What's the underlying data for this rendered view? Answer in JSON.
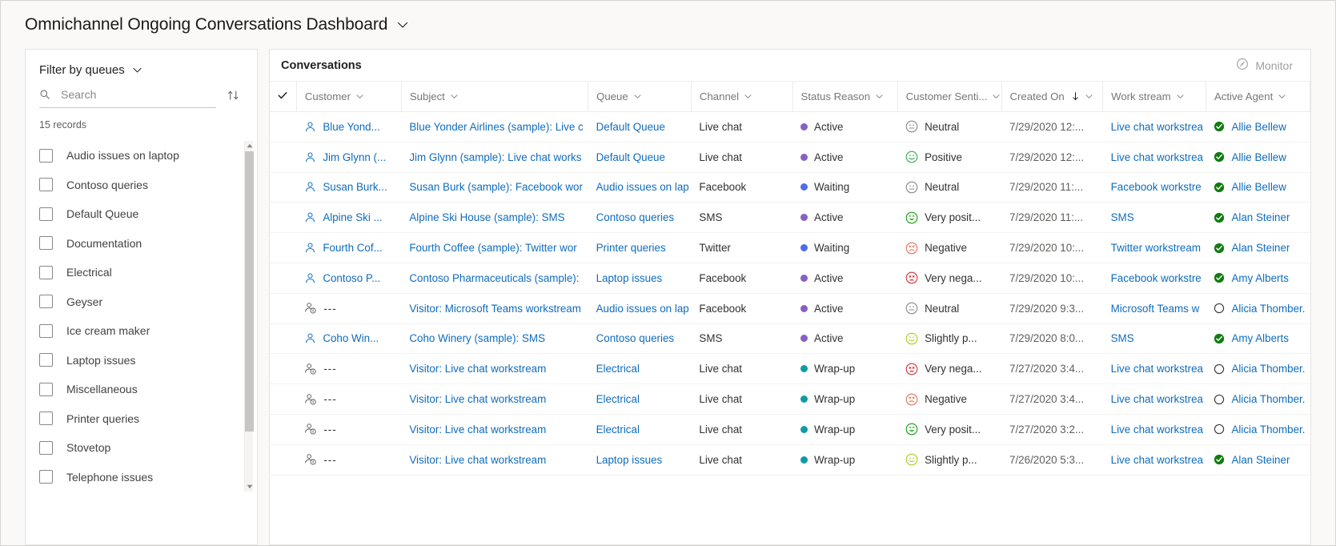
{
  "header": {
    "title": "Omnichannel Ongoing Conversations Dashboard",
    "chevron_icon": "chevron-down-icon"
  },
  "filter_panel": {
    "title": "Filter by queues",
    "chevron_icon": "chevron-down-icon",
    "search": {
      "placeholder": "Search",
      "value": "",
      "icon": "search-icon"
    },
    "sort_toggle_icon": "sort-ascending-descending-icon",
    "record_count": "15 records",
    "queues": [
      {
        "label": "Audio issues on laptop",
        "checked": false
      },
      {
        "label": "Contoso queries",
        "checked": false
      },
      {
        "label": "Default Queue",
        "checked": false
      },
      {
        "label": "Documentation",
        "checked": false
      },
      {
        "label": "Electrical",
        "checked": false
      },
      {
        "label": "Geyser",
        "checked": false
      },
      {
        "label": "Ice cream maker",
        "checked": false
      },
      {
        "label": "Laptop issues",
        "checked": false
      },
      {
        "label": "Miscellaneous",
        "checked": false
      },
      {
        "label": "Printer queries",
        "checked": false
      },
      {
        "label": "Stovetop",
        "checked": false
      },
      {
        "label": "Telephone issues",
        "checked": false
      }
    ]
  },
  "grid": {
    "title": "Conversations",
    "monitor": {
      "label": "Monitor",
      "icon": "gauge-icon"
    },
    "select_all_icon": "checkmark-icon",
    "columns": [
      {
        "label": "Customer",
        "chevron": true,
        "sorted": false
      },
      {
        "label": "Subject",
        "chevron": true,
        "sorted": false
      },
      {
        "label": "Queue",
        "chevron": true,
        "sorted": false
      },
      {
        "label": "Channel",
        "chevron": true,
        "sorted": false
      },
      {
        "label": "Status Reason",
        "chevron": true,
        "sorted": false
      },
      {
        "label": "Customer Senti...",
        "chevron": true,
        "sorted": false
      },
      {
        "label": "Created On",
        "chevron": true,
        "sorted": true,
        "sort_dir": "desc"
      },
      {
        "label": "Work stream",
        "chevron": true,
        "sorted": false
      },
      {
        "label": "Active Agent",
        "chevron": true,
        "sorted": false
      }
    ],
    "status_colors": {
      "Active": "#8661c5",
      "Waiting": "#4f6bed",
      "Wrap-up": "#0e9aa7"
    },
    "sentiment_colors": {
      "Neutral": "#8a8886",
      "Positive": "#3aa655",
      "Very posit...": "#13a10e",
      "Slightly p...": "#a4cf20",
      "Negative": "#e86f54",
      "Very nega...": "#d13438"
    },
    "rows": [
      {
        "customer": "Blue Yond...",
        "customer_icon": "person-icon",
        "subject": "Blue Yonder Airlines (sample): Live c",
        "queue": "Default Queue",
        "queue_link": true,
        "channel": "Live chat",
        "status": "Active",
        "sentiment": "Neutral",
        "created_on": "7/29/2020 12:...",
        "work_stream": "Live chat workstrea",
        "agent": "Allie Bellew",
        "agent_state": "available"
      },
      {
        "customer": "Jim Glynn (...",
        "customer_icon": "person-icon",
        "subject": "Jim Glynn (sample): Live chat works",
        "queue": "Default Queue",
        "queue_link": true,
        "channel": "Live chat",
        "status": "Active",
        "sentiment": "Positive",
        "created_on": "7/29/2020 12:...",
        "work_stream": "Live chat workstrea",
        "agent": "Allie Bellew",
        "agent_state": "available"
      },
      {
        "customer": "Susan Burk...",
        "customer_icon": "person-icon",
        "subject": "Susan Burk (sample): Facebook wor",
        "queue": "Audio issues on lap",
        "queue_link": true,
        "channel": "Facebook",
        "status": "Waiting",
        "sentiment": "Neutral",
        "created_on": "7/29/2020 11:...",
        "work_stream": "Facebook workstre",
        "agent": "Allie Bellew",
        "agent_state": "available"
      },
      {
        "customer": "Alpine Ski ...",
        "customer_icon": "person-icon",
        "subject": "Alpine Ski House (sample): SMS",
        "queue": "Contoso queries",
        "queue_link": true,
        "channel": "SMS",
        "status": "Active",
        "sentiment": "Very posit...",
        "created_on": "7/29/2020 11:...",
        "work_stream": "SMS",
        "agent": "Alan Steiner",
        "agent_state": "available"
      },
      {
        "customer": "Fourth Cof...",
        "customer_icon": "person-icon",
        "subject": "Fourth Coffee (sample): Twitter wor",
        "queue": "Printer queries",
        "queue_link": true,
        "channel": "Twitter",
        "status": "Waiting",
        "sentiment": "Negative",
        "created_on": "7/29/2020 10:...",
        "work_stream": "Twitter workstream",
        "agent": "Alan Steiner",
        "agent_state": "available"
      },
      {
        "customer": "Contoso P...",
        "customer_icon": "person-icon",
        "subject": "Contoso Pharmaceuticals (sample):",
        "queue": "Laptop issues",
        "queue_link": true,
        "channel": "Facebook",
        "status": "Active",
        "sentiment": "Very nega...",
        "created_on": "7/29/2020 10:...",
        "work_stream": "Facebook workstre",
        "agent": "Amy Alberts",
        "agent_state": "available"
      },
      {
        "customer": "---",
        "customer_icon": "visitor-icon",
        "subject": "Visitor: Microsoft Teams workstream",
        "queue": "Audio issues on lap",
        "queue_link": true,
        "channel": "Facebook",
        "status": "Active",
        "sentiment": "Neutral",
        "created_on": "7/29/2020 9:3...",
        "work_stream": "Microsoft Teams w",
        "agent": "Alicia Thomber.",
        "agent_state": "offline"
      },
      {
        "customer": "Coho Win...",
        "customer_icon": "person-icon",
        "subject": "Coho Winery (sample): SMS",
        "queue": "Contoso queries",
        "queue_link": true,
        "channel": "SMS",
        "status": "Active",
        "sentiment": "Slightly p...",
        "created_on": "7/29/2020 8:0...",
        "work_stream": "SMS",
        "agent": "Amy Alberts",
        "agent_state": "available"
      },
      {
        "customer": "---",
        "customer_icon": "visitor-icon",
        "subject": "Visitor: Live chat workstream",
        "queue": "Electrical",
        "queue_link": true,
        "channel": "Live chat",
        "status": "Wrap-up",
        "sentiment": "Very nega...",
        "created_on": "7/27/2020 3:4...",
        "work_stream": "Live chat workstrea",
        "agent": "Alicia Thomber.",
        "agent_state": "offline"
      },
      {
        "customer": "---",
        "customer_icon": "visitor-icon",
        "subject": "Visitor: Live chat workstream",
        "queue": "Electrical",
        "queue_link": true,
        "channel": "Live chat",
        "status": "Wrap-up",
        "sentiment": "Negative",
        "created_on": "7/27/2020 3:4...",
        "work_stream": "Live chat workstrea",
        "agent": "Alicia Thomber.",
        "agent_state": "offline"
      },
      {
        "customer": "---",
        "customer_icon": "visitor-icon",
        "subject": "Visitor: Live chat workstream",
        "queue": "Electrical",
        "queue_link": true,
        "channel": "Live chat",
        "status": "Wrap-up",
        "sentiment": "Very posit...",
        "created_on": "7/27/2020 3:2...",
        "work_stream": "Live chat workstrea",
        "agent": "Alicia Thomber.",
        "agent_state": "offline"
      },
      {
        "customer": "---",
        "customer_icon": "visitor-icon",
        "subject": "Visitor: Live chat workstream",
        "queue": "Laptop issues",
        "queue_link": true,
        "channel": "Live chat",
        "status": "Wrap-up",
        "sentiment": "Slightly p...",
        "created_on": "7/26/2020 5:3...",
        "work_stream": "Live chat workstrea",
        "agent": "Alan Steiner",
        "agent_state": "available"
      }
    ]
  }
}
